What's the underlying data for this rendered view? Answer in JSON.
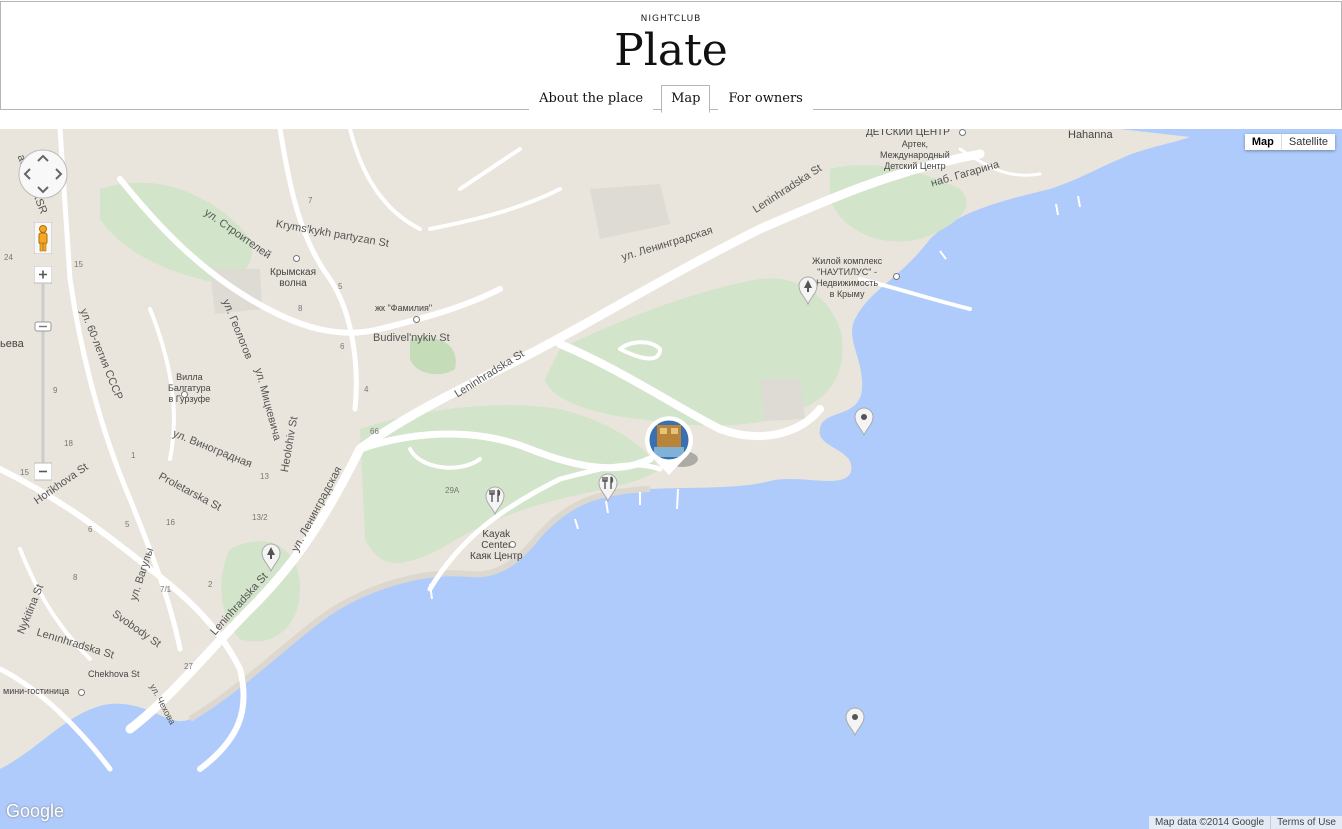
{
  "header": {
    "kicker": "NIGHTCLUB",
    "title": "Plate",
    "tabs": [
      {
        "label": "About the place",
        "active": false
      },
      {
        "label": "Map",
        "active": true
      },
      {
        "label": "For owners",
        "active": false
      }
    ]
  },
  "map": {
    "map_type": {
      "map": "Map",
      "satellite": "Satellite",
      "selected": "Map"
    },
    "labels": {
      "detskiy": "ДЕТСКИЙ ЦЕНТР",
      "hahanna": "Hahanna",
      "artek": "Артек,\nМеждународный\nДетский Центр",
      "nab_gagarina": "наб. Гагарина",
      "leninhradska_st_top": "Leninhradska St",
      "ul_leningradskaya_top": "ул. Ленинградская",
      "nautilus": "Жилой комплекс\n\"НАУТИЛУС\" -\nНедвижимость\nв Крыму",
      "achya_srsr": "achya SRSR",
      "ul_stroiteley": "ул. Строителей",
      "krymskaya_volna": "Крымская\nволна",
      "krymskykh_partyzan": "Kryms'kykh partyzan St",
      "zhk_familiya": "жк \"Фамилия\"",
      "budivelnykiv": "Budivel'nykiv St",
      "leninhradska_st_mid": "Leninhradska St",
      "ul_60_letiya": "ул. 60-летия СССР",
      "ul_geologov": "ул. Геологов",
      "villa": "Вилла\nБалгатура\nв Гурзуфе",
      "ul_mitskevicha": "ул. Мицкевича",
      "heolohiv": "Heolohiv St",
      "ul_vinogradnaya": "ул. Виноградная",
      "ul_leningradskaya_mid": "ул. Ленинградская",
      "horikhova": "Horikhova St",
      "proletarska": "Proletarska St",
      "yeva": "ьева",
      "kayak": "Kayak\nCenter\nКаяк Центр",
      "leninhradska_st_low": "Leninhradska St",
      "nykitina": "Nykitina St",
      "ul_vaguly": "ул. Вагулы",
      "svobody": "Svobody St",
      "leninhradska_st_bottom": "Lenınhradska St",
      "chekhova": "Chekhova St",
      "ul_chekhova": "ул. Чехова",
      "mini_hotel": "мини-гостиница",
      "n7": "7",
      "n5": "5",
      "n8": "8",
      "n6": "6",
      "n4": "4",
      "n66": "66",
      "n29a": "29A",
      "n13": "13",
      "n13_2": "13/2",
      "n16": "16",
      "n2": "2",
      "n7_1": "7/1",
      "n27": "27",
      "n1": "1",
      "n18": "18",
      "n9": "9",
      "n15a": "15",
      "n15b": "15",
      "n24": "24",
      "n5b": "5",
      "n6b": "6",
      "n8b": "8"
    },
    "attribution": {
      "logo": "Google",
      "data": "Map data ©2014 Google",
      "terms": "Terms of Use"
    },
    "colors": {
      "water": "#aecbfb",
      "land": "#e9e5dc",
      "park": "#d2e4c9",
      "road": "#ffffff"
    }
  }
}
